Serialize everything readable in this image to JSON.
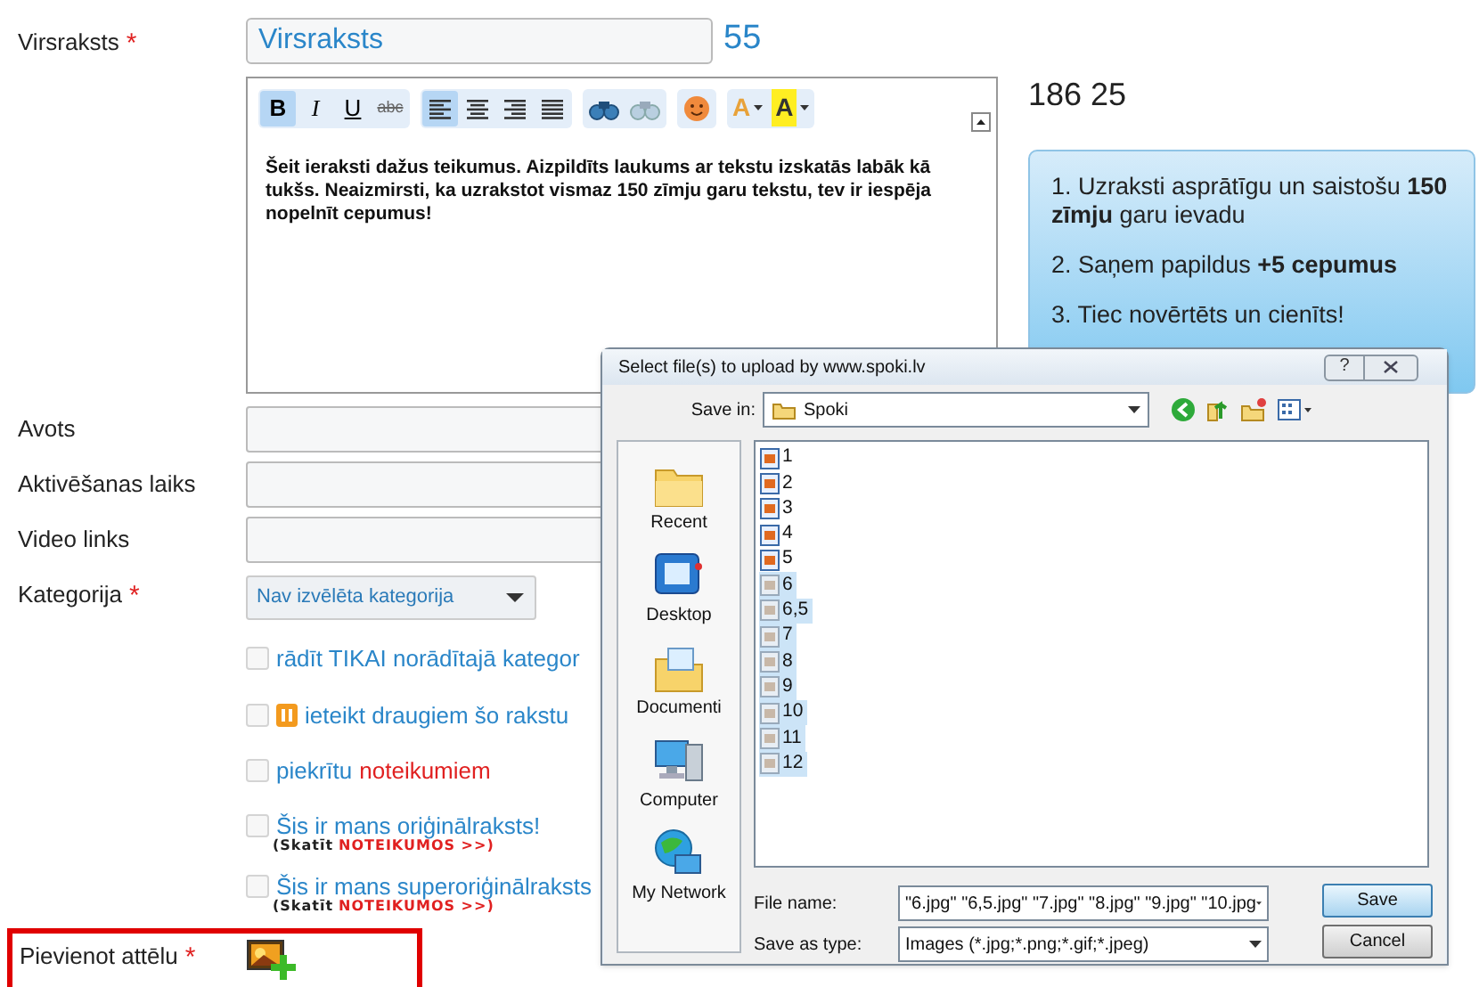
{
  "form": {
    "title_label": "Virsraksts",
    "title_required": "*",
    "title_value": "Virsraksts",
    "title_counter": "55",
    "toolbar": [
      {
        "kind": "bold",
        "label": "B",
        "selected": true
      },
      {
        "kind": "italic",
        "label": "I",
        "selected": false
      },
      {
        "kind": "underline",
        "label": "U",
        "selected": false
      },
      {
        "kind": "strike",
        "label": "abc",
        "selected": false
      },
      {
        "kind": "align-left",
        "selected": true
      },
      {
        "kind": "align-center",
        "selected": false
      },
      {
        "kind": "align-right",
        "selected": false
      },
      {
        "kind": "justify",
        "selected": false
      },
      {
        "kind": "find",
        "selected": false
      },
      {
        "kind": "replace",
        "selected": false
      },
      {
        "kind": "smiley",
        "selected": false
      },
      {
        "kind": "font-color",
        "label": "A",
        "selected": false
      },
      {
        "kind": "highlight",
        "label": "A",
        "selected": false
      }
    ],
    "editor_text": "Šeit ieraksti dažus teikumus. Aizpildīts laukums ar tekstu izskatās labāk kā tukšs. Neaizmirsti, ka uzrakstot vismaz 150 zīmju garu tekstu, tev ir iespēja nopelnīt cepumus!",
    "fields": [
      {
        "label": "Avots"
      },
      {
        "label": "Aktivēšanas laiks"
      },
      {
        "label": "Video links"
      }
    ],
    "category": {
      "label": "Kategorija",
      "required": "*",
      "value": "Nav izvēlēta kategorija"
    },
    "checkboxes": [
      {
        "kind": "plain",
        "text": "rādīt TIKAI norādītajā kategor",
        "checked": false
      },
      {
        "kind": "draugiem",
        "text": "ieteikt draugiem šo rakstu",
        "checked": false
      },
      {
        "kind": "terms",
        "text": "piekrītu",
        "link": "noteikumiem",
        "checked": false
      },
      {
        "kind": "note",
        "text": "Šis ir mans oriģinālraksts!",
        "note": "(Skatīt",
        "note_link": "NOTEIKUMOS >>)",
        "checked": false
      },
      {
        "kind": "note",
        "text": "Šis ir mans superoriģinālraksts",
        "note": "(Skatīt",
        "note_link": "NOTEIKUMOS >>)",
        "checked": false
      }
    ],
    "image": {
      "label": "Pievienot attēlu",
      "required": "*"
    }
  },
  "side": {
    "stats": "186 25",
    "tips": [
      "1. Uzraksti asprātīgu un saistošu **150 zīmju** garu ievadu",
      "2. Saņem papildus **+5 cepumus**",
      "3. Tiec novērtēts un cienīts!"
    ]
  },
  "dialog": {
    "title": "Select file(s) to upload by www.spoki.lv",
    "help": "?",
    "save_in_label": "Save in:",
    "save_in_value": "Spoki",
    "places": [
      {
        "kind": "recent",
        "label": "Recent"
      },
      {
        "kind": "desktop",
        "label": "Desktop"
      },
      {
        "kind": "documents",
        "label": "Documenti"
      },
      {
        "kind": "computer",
        "label": "Computer"
      },
      {
        "kind": "network",
        "label": "My Network"
      }
    ],
    "files": [
      {
        "name": "1",
        "selected": false
      },
      {
        "name": "2",
        "selected": false
      },
      {
        "name": "3",
        "selected": false
      },
      {
        "name": "4",
        "selected": false
      },
      {
        "name": "5",
        "selected": false
      },
      {
        "name": "6",
        "selected": true
      },
      {
        "name": "6,5",
        "selected": true
      },
      {
        "name": "7",
        "selected": true
      },
      {
        "name": "8",
        "selected": true
      },
      {
        "name": "9",
        "selected": true
      },
      {
        "name": "10",
        "selected": true
      },
      {
        "name": "11",
        "selected": true
      },
      {
        "name": "12",
        "selected": true
      }
    ],
    "file_name_label": "File name:",
    "file_name_value": "\"6.jpg\" \"6,5.jpg\" \"7.jpg\" \"8.jpg\" \"9.jpg\" \"10.jpg",
    "type_label": "Save as type:",
    "type_value": "Images (*.jpg;*.png;*.gif;*.jpeg)",
    "buttons": [
      "Save",
      "Cancel"
    ]
  }
}
